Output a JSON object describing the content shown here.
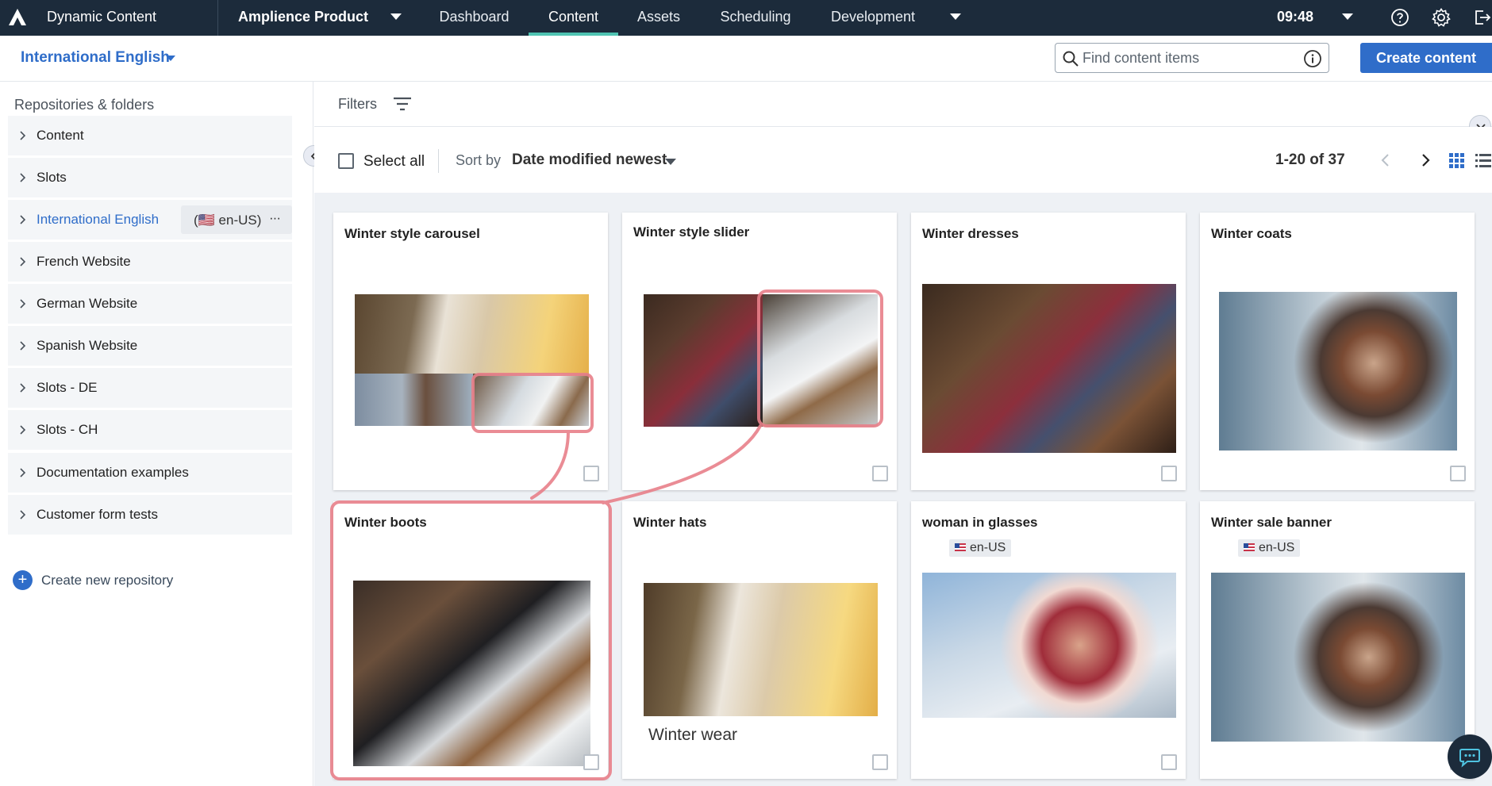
{
  "topnav": {
    "app_name": "Dynamic Content",
    "hub_name": "Amplience Product",
    "tabs": [
      {
        "label": "Dashboard",
        "active": false
      },
      {
        "label": "Content",
        "active": true
      },
      {
        "label": "Assets",
        "active": false
      },
      {
        "label": "Scheduling",
        "active": false
      },
      {
        "label": "Development",
        "active": false
      }
    ],
    "time": "09:48",
    "icons": [
      "amplience-logo-icon",
      "help-icon",
      "settings-icon",
      "logout-icon"
    ]
  },
  "subheader": {
    "locale": "International English",
    "search_placeholder": "Find content items",
    "create_label": "Create content"
  },
  "sidebar": {
    "title": "Repositories & folders",
    "items": [
      {
        "label": "Content"
      },
      {
        "label": "Slots"
      },
      {
        "label": "International English",
        "active": true,
        "locale_tag": "(🇺🇸 en-US)",
        "more": "···"
      },
      {
        "label": "French Website"
      },
      {
        "label": "German Website"
      },
      {
        "label": "Spanish Website"
      },
      {
        "label": "Slots - DE"
      },
      {
        "label": "Slots - CH"
      },
      {
        "label": "Documentation examples"
      },
      {
        "label": "Customer form tests"
      }
    ],
    "create_repo": "Create new repository"
  },
  "filters": {
    "label": "Filters"
  },
  "toolbar": {
    "select_all": "Select all",
    "sort_by": "Sort by",
    "sort_value": "Date modified newest",
    "pager": "1-20 of 37"
  },
  "cards": [
    {
      "title": "Winter style carousel"
    },
    {
      "title": "Winter style slider"
    },
    {
      "title": "Winter dresses"
    },
    {
      "title": "Winter coats"
    },
    {
      "title": "Winter boots"
    },
    {
      "title": "Winter hats",
      "caption": "Winter wear"
    },
    {
      "title": "woman in glasses",
      "tag": "en-US"
    },
    {
      "title": "Winter sale banner",
      "tag": "en-US"
    }
  ],
  "colors": {
    "nav_bg": "#1c2b3b",
    "accent_blue": "#2f6dc9",
    "active_tab_underline": "#4fc3b2",
    "annotation_red": "#e8808a"
  }
}
